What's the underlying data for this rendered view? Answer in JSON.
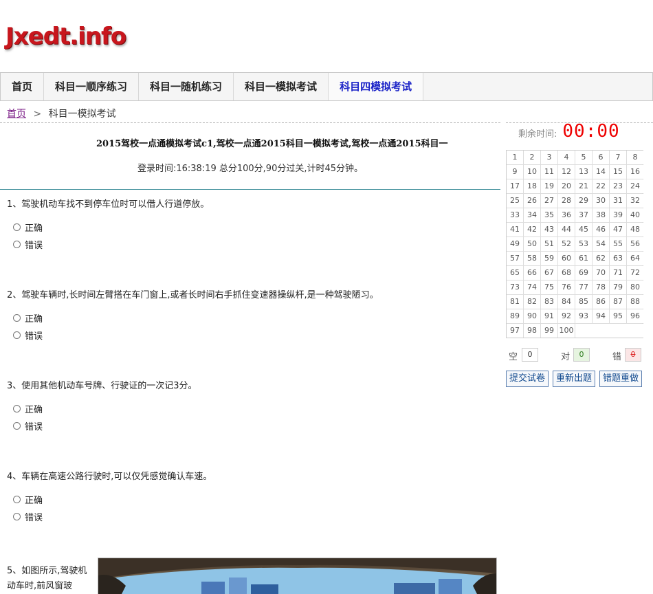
{
  "logo": {
    "text": "Jxedt.info"
  },
  "nav": {
    "items": [
      {
        "label": "首页"
      },
      {
        "label": "科目一顺序练习"
      },
      {
        "label": "科目一随机练习"
      },
      {
        "label": "科目一模拟考试"
      },
      {
        "label": "科目四模拟考试"
      }
    ]
  },
  "breadcrumb": {
    "home": "首页",
    "separator": ">",
    "current": "科目一模拟考试"
  },
  "exam": {
    "title": "2015驾校一点通模拟考试c1,驾校一点通2015科目一模拟考试,驾校一点通2015科目一",
    "info": "登录时间:16:38:19 总分100分,90分过关,计时45分钟。"
  },
  "questions": [
    {
      "text": "1、驾驶机动车找不到停车位时可以借人行道停放。",
      "options": [
        "正确",
        "错误"
      ]
    },
    {
      "text": "2、驾驶车辆时,长时间左臂搭在车门窗上,或者长时间右手抓住变速器操纵杆,是一种驾驶陋习。",
      "options": [
        "正确",
        "错误"
      ]
    },
    {
      "text": "3、使用其他机动车号牌、行驶证的一次记3分。",
      "options": [
        "正确",
        "错误"
      ]
    },
    {
      "text": "4、车辆在高速公路行驶时,可以仅凭感觉确认车速。",
      "options": [
        "正确",
        "错误"
      ]
    },
    {
      "text": "5、如图所示,驾驶机动车时,前风窗玻"
    }
  ],
  "sidebar": {
    "timer_label": "剩余时间:",
    "timer_value": "00:00",
    "numbers": [
      "1",
      "2",
      "3",
      "4",
      "5",
      "6",
      "7",
      "8",
      "9",
      "10",
      "11",
      "12",
      "13",
      "14",
      "15",
      "16",
      "17",
      "18",
      "19",
      "20",
      "21",
      "22",
      "23",
      "24",
      "25",
      "26",
      "27",
      "28",
      "29",
      "30",
      "31",
      "32",
      "33",
      "34",
      "35",
      "36",
      "37",
      "38",
      "39",
      "40",
      "41",
      "42",
      "43",
      "44",
      "45",
      "46",
      "47",
      "48",
      "49",
      "50",
      "51",
      "52",
      "53",
      "54",
      "55",
      "56",
      "57",
      "58",
      "59",
      "60",
      "61",
      "62",
      "63",
      "64",
      "65",
      "66",
      "67",
      "68",
      "69",
      "70",
      "71",
      "72",
      "73",
      "74",
      "75",
      "76",
      "77",
      "78",
      "79",
      "80",
      "81",
      "82",
      "83",
      "84",
      "85",
      "86",
      "87",
      "88",
      "89",
      "90",
      "91",
      "92",
      "93",
      "94",
      "95",
      "96",
      "97",
      "98",
      "99",
      "100"
    ],
    "stats": {
      "empty_label": "空",
      "empty_value": "0",
      "correct_label": "对",
      "correct_value": "0",
      "wrong_label": "错",
      "wrong_value": "0"
    },
    "buttons": {
      "submit": "提交试卷",
      "new_exam": "重新出题",
      "retry_wrong": "错题重做"
    }
  },
  "colors": {
    "brand_red": "#c8161d",
    "active_nav": "#1a22c7",
    "timer": "#e00000",
    "correct_bg": "#e6f4e0",
    "wrong_bg": "#fbe6e6"
  }
}
